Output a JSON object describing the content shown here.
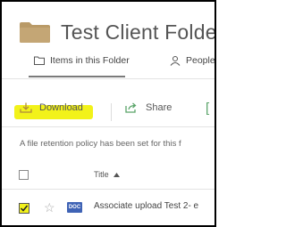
{
  "header": {
    "folder_title": "Test Client Folder"
  },
  "tabs": [
    {
      "label": "Items in this Folder"
    },
    {
      "label": "People"
    }
  ],
  "toolbar": {
    "download_label": "Download",
    "share_label": "Share"
  },
  "notice": {
    "text": "A file retention policy has been set for this f"
  },
  "table": {
    "column_title": "Title",
    "rows": [
      {
        "title": "Associate upload Test 2- e",
        "type": "DOC",
        "checked": true
      }
    ]
  },
  "colors": {
    "highlight": "#f2f21a",
    "doc_icon": "#3f63b5",
    "folder": "#b99a67"
  },
  "icons": [
    "folder-icon",
    "folder-outline-icon",
    "people-icon",
    "download-icon",
    "share-icon",
    "star-icon",
    "doc-icon",
    "sort-up-icon"
  ]
}
